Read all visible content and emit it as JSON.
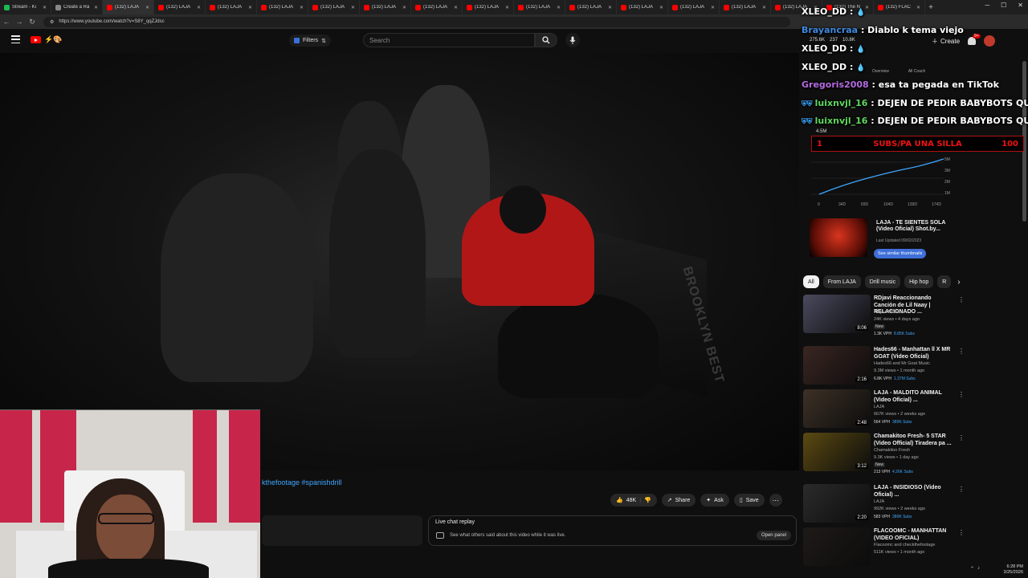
{
  "browser": {
    "tabs": [
      {
        "label": "Stream - Ki",
        "color": "#1db954"
      },
      {
        "label": "Create a Ra",
        "color": "#888888"
      },
      {
        "label": "(132) LAJA",
        "color": "#ff0000"
      },
      {
        "label": "(132) LAJA",
        "color": "#ff0000"
      },
      {
        "label": "(132) LAJA",
        "color": "#ff0000"
      },
      {
        "label": "(132) LAJA",
        "color": "#ff0000"
      },
      {
        "label": "(132) LAJA",
        "color": "#ff0000"
      },
      {
        "label": "(132) LAJA",
        "color": "#ff0000"
      },
      {
        "label": "(132) LAJA",
        "color": "#ff0000"
      },
      {
        "label": "(132) LAJA",
        "color": "#ff0000"
      },
      {
        "label": "(132) LAJA",
        "color": "#ff0000"
      },
      {
        "label": "(132) LAJA",
        "color": "#ff0000"
      },
      {
        "label": "(132) LAJA",
        "color": "#ff0000"
      },
      {
        "label": "(132) LAJA",
        "color": "#ff0000"
      },
      {
        "label": "(132) LAJA",
        "color": "#ff0000"
      },
      {
        "label": "(132) LAJA",
        "color": "#ff0000"
      },
      {
        "label": "(132) The N",
        "color": "#ff0000"
      },
      {
        "label": "(132) FLAC",
        "color": "#ff0000"
      }
    ],
    "url": "https://www.youtube.com/watch?v=S8Y_qqZJdsc"
  },
  "youtube": {
    "filters_label": "Filters",
    "search_placeholder": "Search",
    "create_label": "Create",
    "notif_count": "9+",
    "stats": [
      "275.6K",
      "237",
      "10.8K"
    ]
  },
  "video": {
    "hashtags": "kthefootage #spanishdrill",
    "bg_text": "BROOKLYN BEST"
  },
  "actions": {
    "likes": "48K",
    "share": "Share",
    "ask": "Ask",
    "save": "Save"
  },
  "live_chat": {
    "title": "Live chat replay",
    "subtitle": "See what others said about this video while it was live.",
    "open_panel": "Open panel"
  },
  "stream_chat": [
    {
      "user": "XLEO_DD",
      "text": "",
      "user_color": "#ffffff"
    },
    {
      "user": "Brayancraa",
      "text": "Diablo k tema viejo",
      "user_color": "#3f8ae0"
    },
    {
      "user": "XLEO_DD",
      "text": "",
      "user_color": "#ffffff"
    },
    {
      "user": "XLEO_DD",
      "text": "",
      "user_color": "#ffffff"
    },
    {
      "user": "Gregoris2008",
      "text": "esa ta pegada en TikTok",
      "user_color": "#b46be0"
    },
    {
      "user": "luixnvjl_16",
      "text": "DEJEN DE PEDIR BABYBOTS QU",
      "user_color": "#5fd75f"
    },
    {
      "user": "luixnvjl_16",
      "text": "DEJEN DE PEDIR BABYBOTS QU",
      "user_color": "#5fd75f"
    }
  ],
  "studio": {
    "tabs": [
      "Overview",
      "All Coach"
    ],
    "total_label": "4.5M",
    "chart_x": [
      "0",
      "34D",
      "69D",
      "104D",
      "139D",
      "174D"
    ],
    "chart_y": [
      "5M",
      "3M",
      "2M",
      "1M",
      "0"
    ]
  },
  "goal": {
    "left": "1",
    "text": "SUBS/PA UNA SILLA",
    "right": "100"
  },
  "similar": {
    "title": "LAJA - TE SIENTES SOLA (Video Oficial) Shot.by...",
    "sub": "Last Updated 09/02/2023",
    "button": "See similar thumbnails"
  },
  "chips": [
    {
      "label": "All",
      "active": true
    },
    {
      "label": "From LAJA",
      "active": false
    },
    {
      "label": "Drill music",
      "active": false
    },
    {
      "label": "Hip hop",
      "active": false
    },
    {
      "label": "R",
      "active": false
    }
  ],
  "recommendations": [
    {
      "title": "RDjavi Reaccionando Canción de Lil Naay | RELACIONADO ...",
      "channel": "RDjavi Música",
      "meta": "24K views • 4 days ago",
      "duration": "8:06",
      "new": "New",
      "tag_a": "1.3K VPH",
      "tag_b": "8.85K Subs",
      "thumb": "#4a4a5e"
    },
    {
      "title": "Hades66 - Manhattan ll X MR GOAT (Video Oficial)",
      "channel": "Hades66 and Mr Goat Music",
      "meta": "9.3M views • 1 month ago",
      "duration": "2:16",
      "new": "",
      "tag_a": "6.8K VPH",
      "tag_b": "1.37M Subs",
      "thumb": "#3a2622"
    },
    {
      "title": "LAJA - MALDITO ANIMAL (Video Oficial) ...",
      "channel": "LAJA",
      "meta": "667K views • 2 weeks ago",
      "duration": "2:48",
      "new": "",
      "tag_a": "564 VPH",
      "tag_b": "380K Subs",
      "thumb": "#3d3126"
    },
    {
      "title": "Chamakitoo Fresh- 5 STAR (Video Official) Tiradera pa ...",
      "channel": "Chamakitoo Fresh",
      "meta": "9.3K views • 1 day ago",
      "duration": "3:12",
      "new": "New",
      "tag_a": "213 VPH",
      "tag_b": "4.26K Subs",
      "thumb": "#5b4a12"
    },
    {
      "title": "LAJA - INSIDIOSO (Video Oficial) ...",
      "channel": "LAJA",
      "meta": "992K views • 2 weeks ago",
      "duration": "2:20",
      "new": "",
      "tag_a": "583 VPH",
      "tag_b": "380K Subs",
      "thumb": "#2b2b2b"
    },
    {
      "title": "FLACOOMC - MANHATTAN (VIDEO OFICIAL)",
      "channel": "Flacoomc and checkthefootage",
      "meta": "511K views • 1 month ago",
      "duration": "",
      "new": "",
      "tag_a": "",
      "tag_b": "",
      "thumb": "#1e1a18"
    }
  ],
  "clock": {
    "time": "6:28 PM",
    "date": "3/25/2026"
  }
}
